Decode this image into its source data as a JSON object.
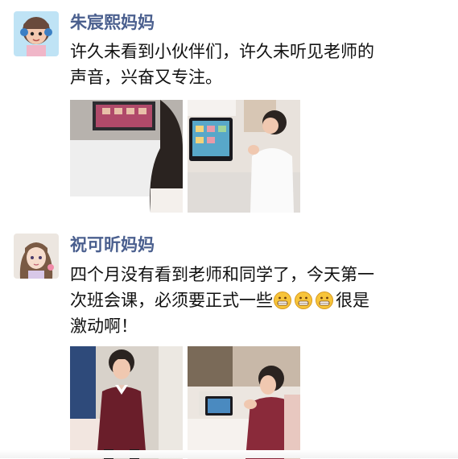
{
  "posts": [
    {
      "author": "朱宸熙妈妈",
      "text": "许久未看到小伙伴们，许久未听见老师的\n声音，兴奋又专注。",
      "avatar_icon": "cartoon-girl-avatar-icon",
      "photos": [
        "child-online-class-photo",
        "child-watching-laptop-photo"
      ]
    },
    {
      "author": "祝可昕妈妈",
      "text_line1": "四个月没有看到老师和同学了，今天第一",
      "text_line2_before": "次班会课，必须要正式一些",
      "text_line2_after": "很是",
      "text_line3": "激动啊！",
      "emoji_icon": "grinning-face-icon",
      "emoji_count": 3,
      "avatar_icon": "anime-girl-avatar-icon",
      "photos": [
        "child-in-uniform-photo",
        "child-at-tablet-photo"
      ]
    }
  ],
  "colors": {
    "author": "#4a5f8e",
    "text": "#111111",
    "background": "#ffffff"
  }
}
